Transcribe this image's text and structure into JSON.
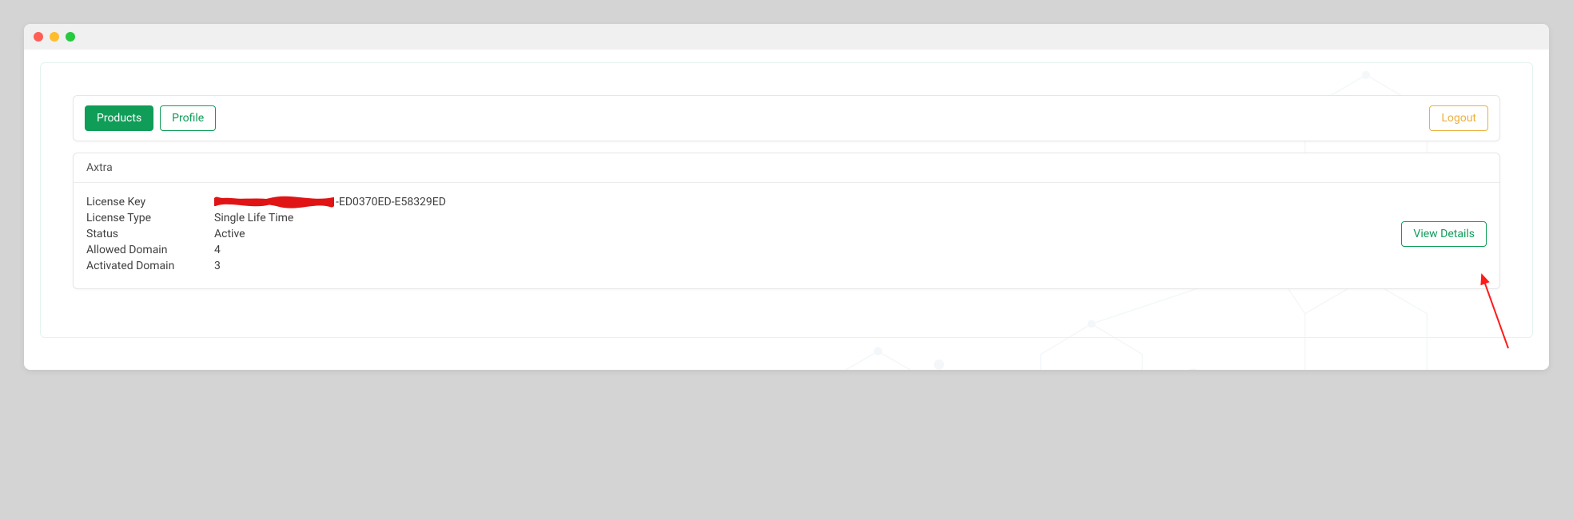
{
  "tabs": {
    "products": "Products",
    "profile": "Profile",
    "logout": "Logout"
  },
  "product": {
    "name": "Axtra",
    "license_key_label": "License Key",
    "license_key_visible_suffix": "-ED0370ED-E58329ED",
    "license_type_label": "License Type",
    "license_type_value": "Single Life Time",
    "status_label": "Status",
    "status_value": "Active",
    "allowed_domain_label": "Allowed Domain",
    "allowed_domain_value": "4",
    "activated_domain_label": "Activated Domain",
    "activated_domain_value": "3",
    "view_details_label": "View Details"
  }
}
